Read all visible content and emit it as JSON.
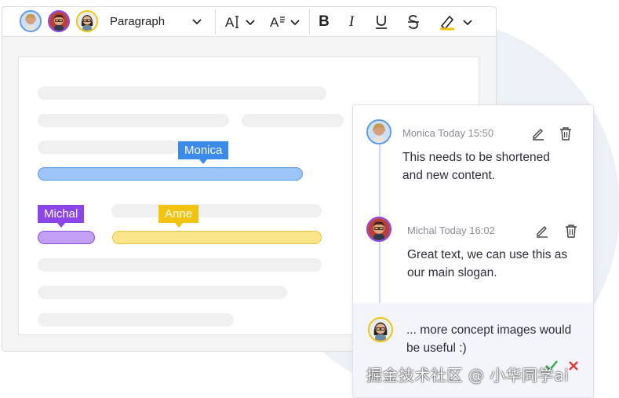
{
  "toolbar": {
    "avatars": [
      "monica",
      "michal",
      "anne"
    ],
    "block_format": "Paragraph",
    "icons": [
      "font-size-icon",
      "text-format-icon",
      "bold-icon",
      "italic-icon",
      "underline-icon",
      "strikethrough-icon",
      "highlight-icon"
    ],
    "colors": {
      "accent": "#f2c40f"
    }
  },
  "document": {
    "tags": [
      {
        "name": "Monica",
        "color": "#3d8be8"
      },
      {
        "name": "Michal",
        "color": "#8b45e8"
      },
      {
        "name": "Anne",
        "color": "#f2c40f"
      }
    ]
  },
  "comments": {
    "items": [
      {
        "author": "Monica",
        "meta": "Monica Today 15:50",
        "text": "This needs to be shortened and new content."
      },
      {
        "author": "Michal",
        "meta": "Michal Today 16:02",
        "text": "Great text, we can use this as our main slogan."
      }
    ],
    "reply": {
      "text": "... more concept images would be useful :)"
    },
    "icons": [
      "edit-icon",
      "delete-icon",
      "accept-icon",
      "reject-icon"
    ]
  },
  "watermark": "掘金技术社区 @ 小华同学ai"
}
